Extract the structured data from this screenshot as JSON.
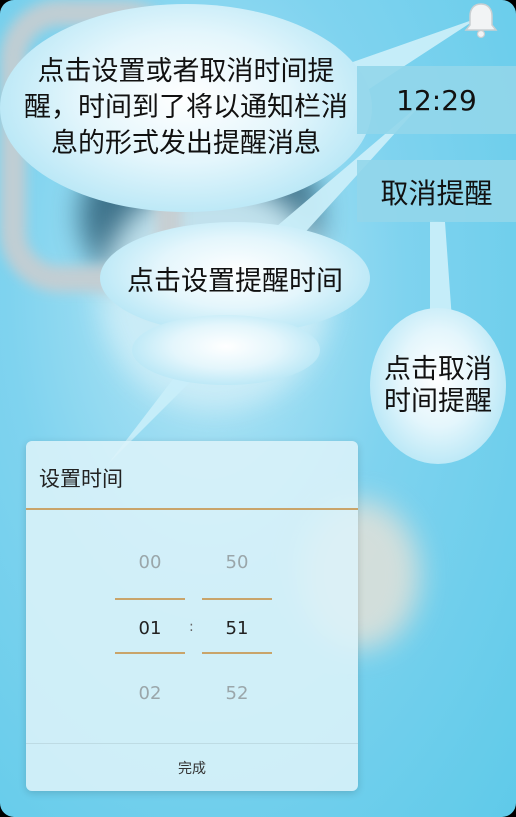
{
  "tooltips": {
    "main": [
      "点击设置或者取消时间提",
      "醒，时间到了将以通知栏消",
      "息的形式发出提醒消息"
    ],
    "set_time": "点击设置提醒时间",
    "cancel": [
      "点击取消",
      "时间提醒"
    ]
  },
  "panel": {
    "time_value": "12:29",
    "cancel_label": "取消提醒"
  },
  "dialog": {
    "title": "设置时间",
    "hours": {
      "prev": "00",
      "selected": "01",
      "next": "02"
    },
    "minutes": {
      "prev": "50",
      "selected": "51",
      "next": "52"
    },
    "separator": ":",
    "done_label": "完成"
  },
  "colors": {
    "accent": "#c9a46a",
    "background": "#5fcae9"
  },
  "icons": {
    "bell": "bell-icon"
  }
}
